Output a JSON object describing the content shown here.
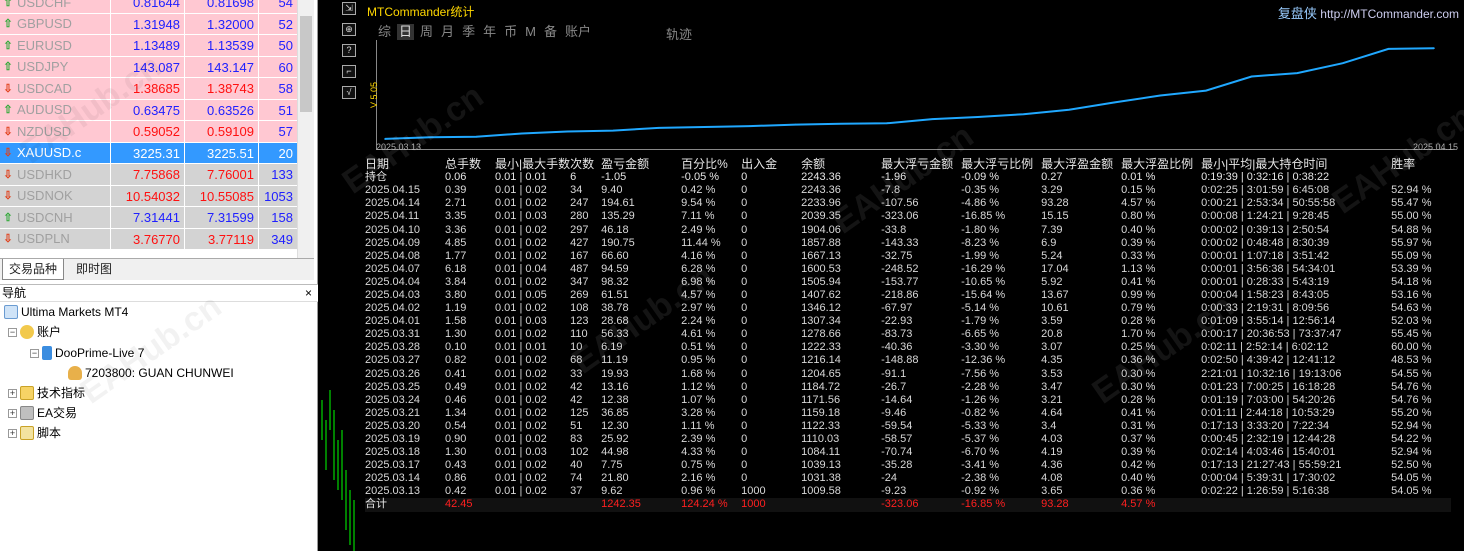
{
  "market_watch": {
    "rows": [
      {
        "symbol": "USDCHF",
        "bid": "0.81644",
        "ask": "0.81698",
        "spread": "54",
        "dir": "up",
        "bg": "#ffc8d2",
        "fg": "#2020ff"
      },
      {
        "symbol": "GBPUSD",
        "bid": "1.31948",
        "ask": "1.32000",
        "spread": "52",
        "dir": "up",
        "bg": "#ffc8d2",
        "fg": "#2020ff"
      },
      {
        "symbol": "EURUSD",
        "bid": "1.13489",
        "ask": "1.13539",
        "spread": "50",
        "dir": "up",
        "bg": "#ffc8d2",
        "fg": "#2020ff"
      },
      {
        "symbol": "USDJPY",
        "bid": "143.087",
        "ask": "143.147",
        "spread": "60",
        "dir": "up",
        "bg": "#ffc8d2",
        "fg": "#2020ff"
      },
      {
        "symbol": "USDCAD",
        "bid": "1.38685",
        "ask": "1.38743",
        "spread": "58",
        "dir": "down",
        "bg": "#ffc8d2",
        "fg": "#ff1010"
      },
      {
        "symbol": "AUDUSD",
        "bid": "0.63475",
        "ask": "0.63526",
        "spread": "51",
        "dir": "up",
        "bg": "#ffc8d2",
        "fg": "#2020ff"
      },
      {
        "symbol": "NZDUSD",
        "bid": "0.59052",
        "ask": "0.59109",
        "spread": "57",
        "dir": "down",
        "bg": "#ffc8d2",
        "fg": "#ff1010"
      },
      {
        "symbol": "XAUUSD.c",
        "bid": "3225.31",
        "ask": "3225.51",
        "spread": "20",
        "dir": "down",
        "bg": "#3399ff",
        "fg": "#ffffff",
        "selected": true
      },
      {
        "symbol": "USDHKD",
        "bid": "7.75868",
        "ask": "7.76001",
        "spread": "133",
        "dir": "down",
        "bg": "#d3d3d3",
        "fg": "#ff1010"
      },
      {
        "symbol": "USDNOK",
        "bid": "10.54032",
        "ask": "10.55085",
        "spread": "1053",
        "dir": "down",
        "bg": "#d3d3d3",
        "fg": "#ff1010"
      },
      {
        "symbol": "USDCNH",
        "bid": "7.31441",
        "ask": "7.31599",
        "spread": "158",
        "dir": "up",
        "bg": "#d3d3d3",
        "fg": "#2020ff"
      },
      {
        "symbol": "USDPLN",
        "bid": "3.76770",
        "ask": "3.77119",
        "spread": "349",
        "dir": "down",
        "bg": "#d3d3d3",
        "fg": "#ff1010"
      }
    ],
    "tabs": [
      "交易品种",
      "即时图"
    ]
  },
  "navigator": {
    "title": "导航",
    "close": "×",
    "root": "Ultima Markets MT4",
    "accounts": "账户",
    "server": "DooPrime-Live 7",
    "account": "7203800: GUAN CHUNWEI",
    "indicators": "技术指标",
    "ea": "EA交易",
    "scripts": "脚本"
  },
  "toolbar": [
    "⇲",
    "⊕",
    "?",
    "⌐",
    "√"
  ],
  "panel": {
    "title": "MTCommander统计",
    "brand_cn": "复盘侠",
    "brand_url": "http://MTCommander.com",
    "periods": [
      "综",
      "日",
      "周",
      "月",
      "季",
      "年",
      "币",
      "M",
      "备",
      "账户"
    ],
    "active_period": "日",
    "track": "轨迹",
    "vlabel": "V 5.05",
    "date_start": "2025.03.13",
    "date_end": "2025.04.15"
  },
  "colors": {
    "accent": "#20a8ff",
    "profit": "#20ff40",
    "loss": "#ff2020"
  },
  "table": {
    "headers": [
      "日期",
      "总手数",
      "最小|最大手数",
      "次数",
      "盈亏金额",
      "百分比%",
      "出入金",
      "余额",
      "最大浮亏金额",
      "最大浮亏比例",
      "最大浮盈金额",
      "最大浮盈比例",
      "最小|平均|最大持仓时间",
      "胜率"
    ],
    "holding": [
      "持仓",
      "0.06",
      "0.01 | 0.01",
      "6",
      "-1.05",
      "-0.05 %",
      "0",
      "2243.36",
      "-1.96",
      "-0.09 %",
      "0.27",
      "0.01 %",
      "0:19:39 | 0:32:16 | 0:38:22",
      ""
    ],
    "rows": [
      [
        "2025.04.15",
        "0.39",
        "0.01 | 0.02",
        "34",
        "9.40",
        "0.42 %",
        "0",
        "2243.36",
        "-7.8",
        "-0.35 %",
        "3.29",
        "0.15 %",
        "0:02:25 | 3:01:59 | 6:45:08",
        "52.94 %"
      ],
      [
        "2025.04.14",
        "2.71",
        "0.01 | 0.02",
        "247",
        "194.61",
        "9.54 %",
        "0",
        "2233.96",
        "-107.56",
        "-4.86 %",
        "93.28",
        "4.57 %",
        "0:00:21 | 2:53:34 | 50:55:58",
        "55.47 %"
      ],
      [
        "2025.04.11",
        "3.35",
        "0.01 | 0.03",
        "280",
        "135.29",
        "7.11 %",
        "0",
        "2039.35",
        "-323.06",
        "-16.85 %",
        "15.15",
        "0.80 %",
        "0:00:08 | 1:24:21 | 9:28:45",
        "55.00 %"
      ],
      [
        "2025.04.10",
        "3.36",
        "0.01 | 0.02",
        "297",
        "46.18",
        "2.49 %",
        "0",
        "1904.06",
        "-33.8",
        "-1.80 %",
        "7.39",
        "0.40 %",
        "0:00:02 | 0:39:13 | 2:50:54",
        "54.88 %"
      ],
      [
        "2025.04.09",
        "4.85",
        "0.01 | 0.02",
        "427",
        "190.75",
        "11.44 %",
        "0",
        "1857.88",
        "-143.33",
        "-8.23 %",
        "6.9",
        "0.39 %",
        "0:00:02 | 0:48:48 | 8:30:39",
        "55.97 %"
      ],
      [
        "2025.04.08",
        "1.77",
        "0.01 | 0.02",
        "167",
        "66.60",
        "4.16 %",
        "0",
        "1667.13",
        "-32.75",
        "-1.99 %",
        "5.24",
        "0.33 %",
        "0:00:01 | 1:07:18 | 3:51:42",
        "55.09 %"
      ],
      [
        "2025.04.07",
        "6.18",
        "0.01 | 0.04",
        "487",
        "94.59",
        "6.28 %",
        "0",
        "1600.53",
        "-248.52",
        "-16.29 %",
        "17.04",
        "1.13 %",
        "0:00:01 | 3:56:38 | 54:34:01",
        "53.39 %"
      ],
      [
        "2025.04.04",
        "3.84",
        "0.01 | 0.02",
        "347",
        "98.32",
        "6.98 %",
        "0",
        "1505.94",
        "-153.77",
        "-10.65 %",
        "5.92",
        "0.41 %",
        "0:00:01 | 0:28:33 | 5:43:19",
        "54.18 %"
      ],
      [
        "2025.04.03",
        "3.80",
        "0.01 | 0.05",
        "269",
        "61.51",
        "4.57 %",
        "0",
        "1407.62",
        "-218.86",
        "-15.64 %",
        "13.67",
        "0.99 %",
        "0:00:04 | 1:58:23 | 8:43:05",
        "53.16 %"
      ],
      [
        "2025.04.02",
        "1.19",
        "0.01 | 0.02",
        "108",
        "38.78",
        "2.97 %",
        "0",
        "1346.12",
        "-67.97",
        "-5.14 %",
        "10.61",
        "0.79 %",
        "0:00:33 | 2:19:31 | 8:09:56",
        "54.63 %"
      ],
      [
        "2025.04.01",
        "1.58",
        "0.01 | 0.03",
        "123",
        "28.68",
        "2.24 %",
        "0",
        "1307.34",
        "-22.93",
        "-1.79 %",
        "3.59",
        "0.28 %",
        "0:01:09 | 3:55:14 | 12:56:14",
        "52.03 %"
      ],
      [
        "2025.03.31",
        "1.30",
        "0.01 | 0.02",
        "110",
        "56.33",
        "4.61 %",
        "0",
        "1278.66",
        "-83.73",
        "-6.65 %",
        "20.8",
        "1.70 %",
        "0:00:17 | 20:36:53 | 73:37:47",
        "55.45 %"
      ],
      [
        "2025.03.28",
        "0.10",
        "0.01 | 0.01",
        "10",
        "6.19",
        "0.51 %",
        "0",
        "1222.33",
        "-40.36",
        "-3.30 %",
        "3.07",
        "0.25 %",
        "0:02:11 | 2:52:14 | 6:02:12",
        "60.00 %"
      ],
      [
        "2025.03.27",
        "0.82",
        "0.01 | 0.02",
        "68",
        "11.19",
        "0.95 %",
        "0",
        "1216.14",
        "-148.88",
        "-12.36 %",
        "4.35",
        "0.36 %",
        "0:02:50 | 4:39:42 | 12:41:12",
        "48.53 %"
      ],
      [
        "2025.03.26",
        "0.41",
        "0.01 | 0.02",
        "33",
        "19.93",
        "1.68 %",
        "0",
        "1204.65",
        "-91.1",
        "-7.56 %",
        "3.53",
        "0.30 %",
        "2:21:01 | 10:32:16 | 19:13:06",
        "54.55 %"
      ],
      [
        "2025.03.25",
        "0.49",
        "0.01 | 0.02",
        "42",
        "13.16",
        "1.12 %",
        "0",
        "1184.72",
        "-26.7",
        "-2.28 %",
        "3.47",
        "0.30 %",
        "0:01:23 | 7:00:25 | 16:18:28",
        "54.76 %"
      ],
      [
        "2025.03.24",
        "0.46",
        "0.01 | 0.02",
        "42",
        "12.38",
        "1.07 %",
        "0",
        "1171.56",
        "-14.64",
        "-1.26 %",
        "3.21",
        "0.28 %",
        "0:01:19 | 7:03:00 | 54:20:26",
        "54.76 %"
      ],
      [
        "2025.03.21",
        "1.34",
        "0.01 | 0.02",
        "125",
        "36.85",
        "3.28 %",
        "0",
        "1159.18",
        "-9.46",
        "-0.82 %",
        "4.64",
        "0.41 %",
        "0:01:11 | 2:44:18 | 10:53:29",
        "55.20 %"
      ],
      [
        "2025.03.20",
        "0.54",
        "0.01 | 0.02",
        "51",
        "12.30",
        "1.11 %",
        "0",
        "1122.33",
        "-59.54",
        "-5.33 %",
        "3.4",
        "0.31 %",
        "0:17:13 | 3:33:20 | 7:22:34",
        "52.94 %"
      ],
      [
        "2025.03.19",
        "0.90",
        "0.01 | 0.02",
        "83",
        "25.92",
        "2.39 %",
        "0",
        "1110.03",
        "-58.57",
        "-5.37 %",
        "4.03",
        "0.37 %",
        "0:00:45 | 2:32:19 | 12:44:28",
        "54.22 %"
      ],
      [
        "2025.03.18",
        "1.30",
        "0.01 | 0.03",
        "102",
        "44.98",
        "4.33 %",
        "0",
        "1084.11",
        "-70.74",
        "-6.70 %",
        "4.19",
        "0.39 %",
        "0:02:14 | 4:03:46 | 15:40:01",
        "52.94 %"
      ],
      [
        "2025.03.17",
        "0.43",
        "0.01 | 0.02",
        "40",
        "7.75",
        "0.75 %",
        "0",
        "1039.13",
        "-35.28",
        "-3.41 %",
        "4.36",
        "0.42 %",
        "0:17:13 | 21:27:43 | 55:59:21",
        "52.50 %"
      ],
      [
        "2025.03.14",
        "0.86",
        "0.01 | 0.02",
        "74",
        "21.80",
        "2.16 %",
        "0",
        "1031.38",
        "-24",
        "-2.38 %",
        "4.08",
        "0.40 %",
        "0:00:04 | 5:39:31 | 17:30:02",
        "54.05 %"
      ],
      [
        "2025.03.13",
        "0.42",
        "0.01 | 0.02",
        "37",
        "9.62",
        "0.96 %",
        "1000",
        "1009.58",
        "-9.23",
        "-0.92 %",
        "3.65",
        "0.36 %",
        "0:02:22 | 1:26:59 | 5:16:38",
        "54.05 %"
      ]
    ],
    "total": [
      "合计",
      "42.45",
      "",
      "",
      "1242.35",
      "124.24 %",
      "1000",
      "",
      "-323.06",
      "-16.85 %",
      "93.28",
      "4.57 %",
      "",
      ""
    ]
  },
  "chart_data": {
    "type": "line",
    "x": [
      "2025.03.13",
      "2025.03.14",
      "2025.03.17",
      "2025.03.18",
      "2025.03.19",
      "2025.03.20",
      "2025.03.21",
      "2025.03.24",
      "2025.03.25",
      "2025.03.26",
      "2025.03.27",
      "2025.03.28",
      "2025.03.31",
      "2025.04.01",
      "2025.04.02",
      "2025.04.03",
      "2025.04.04",
      "2025.04.07",
      "2025.04.08",
      "2025.04.09",
      "2025.04.10",
      "2025.04.11",
      "2025.04.14",
      "2025.04.15"
    ],
    "series": [
      {
        "values": [
          1009.58,
          1031.38,
          1039.13,
          1084.11,
          1110.03,
          1122.33,
          1159.18,
          1171.56,
          1184.72,
          1204.65,
          1216.14,
          1222.33,
          1278.66,
          1307.34,
          1346.12,
          1407.62,
          1505.94,
          1600.53,
          1667.13,
          1857.88,
          1904.06,
          2039.35,
          2233.96,
          2243.36
        ]
      }
    ],
    "xlabel": "",
    "ylabel": ""
  },
  "watermark": "EAHub.cn"
}
